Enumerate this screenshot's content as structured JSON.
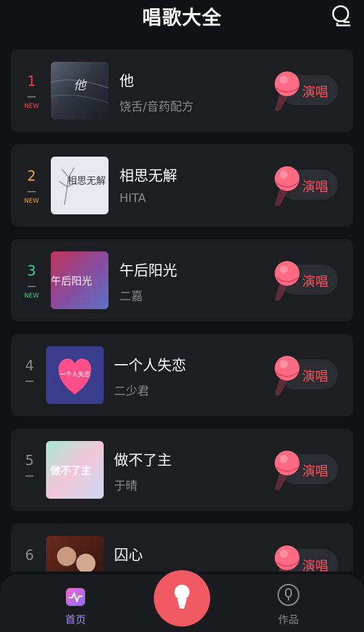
{
  "header": {
    "title": "唱歌大全",
    "profile_icon": "user-icon"
  },
  "songs": [
    {
      "rank": "1",
      "title": "他",
      "artist": "饶舌/音药配方",
      "new": "NEW",
      "rank_color": "#e8404a",
      "cover_text": "他"
    },
    {
      "rank": "2",
      "title": "相思无解",
      "artist": "HITA",
      "new": "NEW",
      "rank_color": "#f0a23a",
      "cover_text": "相思无解"
    },
    {
      "rank": "3",
      "title": "午后阳光",
      "artist": "二嘉",
      "new": "NEW",
      "rank_color": "#3fcf8e",
      "cover_text": "午后阳光"
    },
    {
      "rank": "4",
      "title": "一个人失恋",
      "artist": "二少君",
      "new": "",
      "rank_color": "#8a8b90",
      "cover_text": "一个人失恋"
    },
    {
      "rank": "5",
      "title": "做不了主",
      "artist": "于晴",
      "new": "",
      "rank_color": "#8a8b90",
      "cover_text": "做不了主"
    },
    {
      "rank": "6",
      "title": "囚心",
      "artist": "",
      "new": "",
      "rank_color": "#8a8b90",
      "cover_text": ""
    }
  ],
  "sing_label": "演唱",
  "tabbar": {
    "home_label": "首页",
    "works_label": "作品",
    "active_color": "#a58cf2",
    "inactive_color": "#8a8b90",
    "accent": "#f25a63"
  }
}
